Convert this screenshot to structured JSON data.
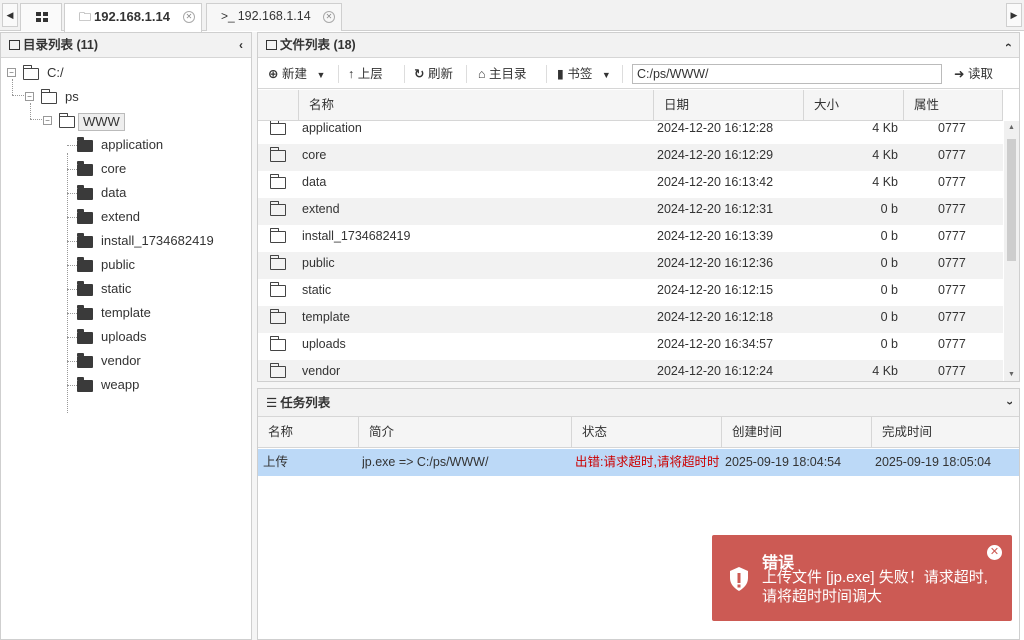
{
  "tabs": [
    {
      "label": "192.168.1.14",
      "icon": "folder-icon",
      "active": true
    },
    {
      "label": "192.168.1.14",
      "icon": "terminal-icon",
      "active": false
    }
  ],
  "left_panel": {
    "title": "目录列表 (11)",
    "tree": {
      "root": "C:/",
      "level1": "ps",
      "level2": "WWW",
      "children": [
        "application",
        "core",
        "data",
        "extend",
        "install_1734682419",
        "public",
        "static",
        "template",
        "uploads",
        "vendor",
        "weapp"
      ]
    }
  },
  "file_panel": {
    "title": "文件列表 (18)",
    "toolbar": {
      "new_label": "新建",
      "up_label": "上层",
      "refresh_label": "刷新",
      "home_label": "主目录",
      "bookmark_label": "书签",
      "path_value": "C:/ps/WWW/",
      "read_label": "读取"
    },
    "columns": [
      "名称",
      "日期",
      "大小",
      "属性"
    ],
    "rows": [
      {
        "name": "application",
        "date": "2024-12-20 16:12:28",
        "size": "4 Kb",
        "attr": "0777"
      },
      {
        "name": "core",
        "date": "2024-12-20 16:12:29",
        "size": "4 Kb",
        "attr": "0777"
      },
      {
        "name": "data",
        "date": "2024-12-20 16:13:42",
        "size": "4 Kb",
        "attr": "0777"
      },
      {
        "name": "extend",
        "date": "2024-12-20 16:12:31",
        "size": "0 b",
        "attr": "0777"
      },
      {
        "name": "install_1734682419",
        "date": "2024-12-20 16:13:39",
        "size": "0 b",
        "attr": "0777"
      },
      {
        "name": "public",
        "date": "2024-12-20 16:12:36",
        "size": "0 b",
        "attr": "0777"
      },
      {
        "name": "static",
        "date": "2024-12-20 16:12:15",
        "size": "0 b",
        "attr": "0777"
      },
      {
        "name": "template",
        "date": "2024-12-20 16:12:18",
        "size": "0 b",
        "attr": "0777"
      },
      {
        "name": "uploads",
        "date": "2024-12-20 16:34:57",
        "size": "0 b",
        "attr": "0777"
      },
      {
        "name": "vendor",
        "date": "2024-12-20 16:12:24",
        "size": "4 Kb",
        "attr": "0777"
      }
    ]
  },
  "task_panel": {
    "title": "任务列表",
    "columns": [
      "名称",
      "简介",
      "状态",
      "创建时间",
      "完成时间"
    ],
    "rows": [
      {
        "name": "上传",
        "desc": "jp.exe => C:/ps/WWW/",
        "status": "出错:请求超时,请将超时时间调大",
        "created": "2025-09-19 18:04:54",
        "finished": "2025-09-19 18:05:04"
      }
    ]
  },
  "toast": {
    "title": "错误",
    "message": "上传文件 [jp.exe] 失败！请求超时,请将超时时间调大",
    "bg_color": "#cc5a54"
  },
  "colors": {
    "selected_row": "#bcd9f7",
    "error_text": "#cc0000"
  }
}
